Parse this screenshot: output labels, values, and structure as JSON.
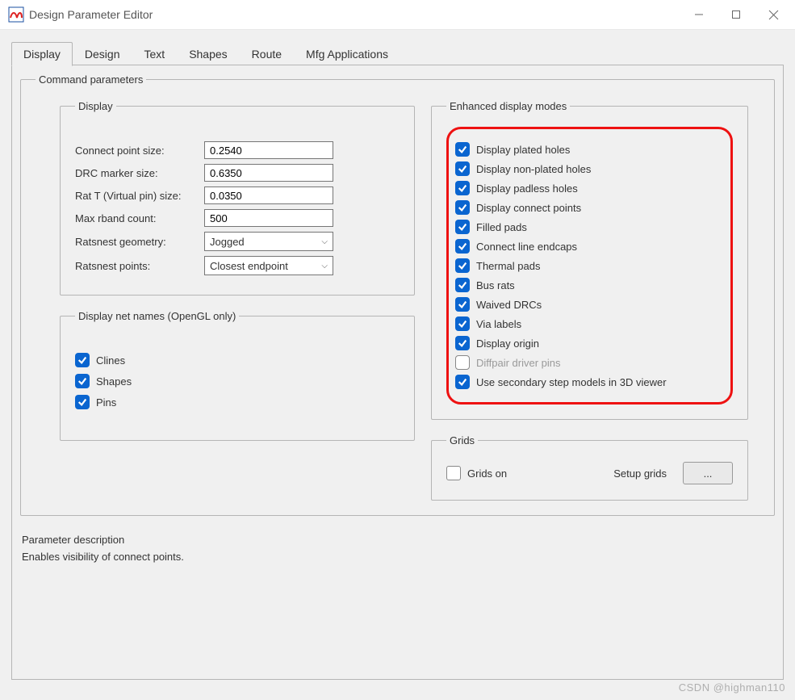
{
  "window": {
    "title": "Design Parameter Editor"
  },
  "tabs": [
    "Display",
    "Design",
    "Text",
    "Shapes",
    "Route",
    "Mfg Applications"
  ],
  "active_tab": 0,
  "groups": {
    "command": "Command parameters",
    "display": "Display",
    "netnames": "Display net names (OpenGL only)",
    "enhanced": "Enhanced display modes",
    "grids": "Grids",
    "param_desc": "Parameter description"
  },
  "display_form": {
    "connect_point_size": {
      "label": "Connect point size:",
      "value": "0.2540"
    },
    "drc_marker_size": {
      "label": "DRC marker size:",
      "value": "0.6350"
    },
    "rat_t_size": {
      "label": "Rat T (Virtual pin) size:",
      "value": "0.0350"
    },
    "max_rband_count": {
      "label": "Max rband count:",
      "value": "500"
    },
    "ratsnest_geometry": {
      "label": "Ratsnest geometry:",
      "value": "Jogged"
    },
    "ratsnest_points": {
      "label": "Ratsnest points:",
      "value": "Closest endpoint"
    }
  },
  "netnames": [
    {
      "label": "Clines",
      "checked": true
    },
    {
      "label": "Shapes",
      "checked": true
    },
    {
      "label": "Pins",
      "checked": true
    }
  ],
  "enhanced": [
    {
      "label": "Display plated holes",
      "checked": true,
      "disabled": false
    },
    {
      "label": "Display non-plated holes",
      "checked": true,
      "disabled": false
    },
    {
      "label": "Display padless holes",
      "checked": true,
      "disabled": false
    },
    {
      "label": "Display connect points",
      "checked": true,
      "disabled": false
    },
    {
      "label": "Filled pads",
      "checked": true,
      "disabled": false
    },
    {
      "label": "Connect line endcaps",
      "checked": true,
      "disabled": false
    },
    {
      "label": "Thermal pads",
      "checked": true,
      "disabled": false
    },
    {
      "label": "Bus rats",
      "checked": true,
      "disabled": false
    },
    {
      "label": "Waived DRCs",
      "checked": true,
      "disabled": false
    },
    {
      "label": "Via labels",
      "checked": true,
      "disabled": false
    },
    {
      "label": "Display origin",
      "checked": true,
      "disabled": false
    },
    {
      "label": "Diffpair driver pins",
      "checked": false,
      "disabled": true
    },
    {
      "label": "Use secondary step models in 3D viewer",
      "checked": true,
      "disabled": false
    }
  ],
  "grids": {
    "grids_on": {
      "label": "Grids on",
      "checked": false
    },
    "setup_label": "Setup grids",
    "button": "..."
  },
  "param_desc_text": "Enables visibility of connect points.",
  "watermark": "CSDN @highman110"
}
